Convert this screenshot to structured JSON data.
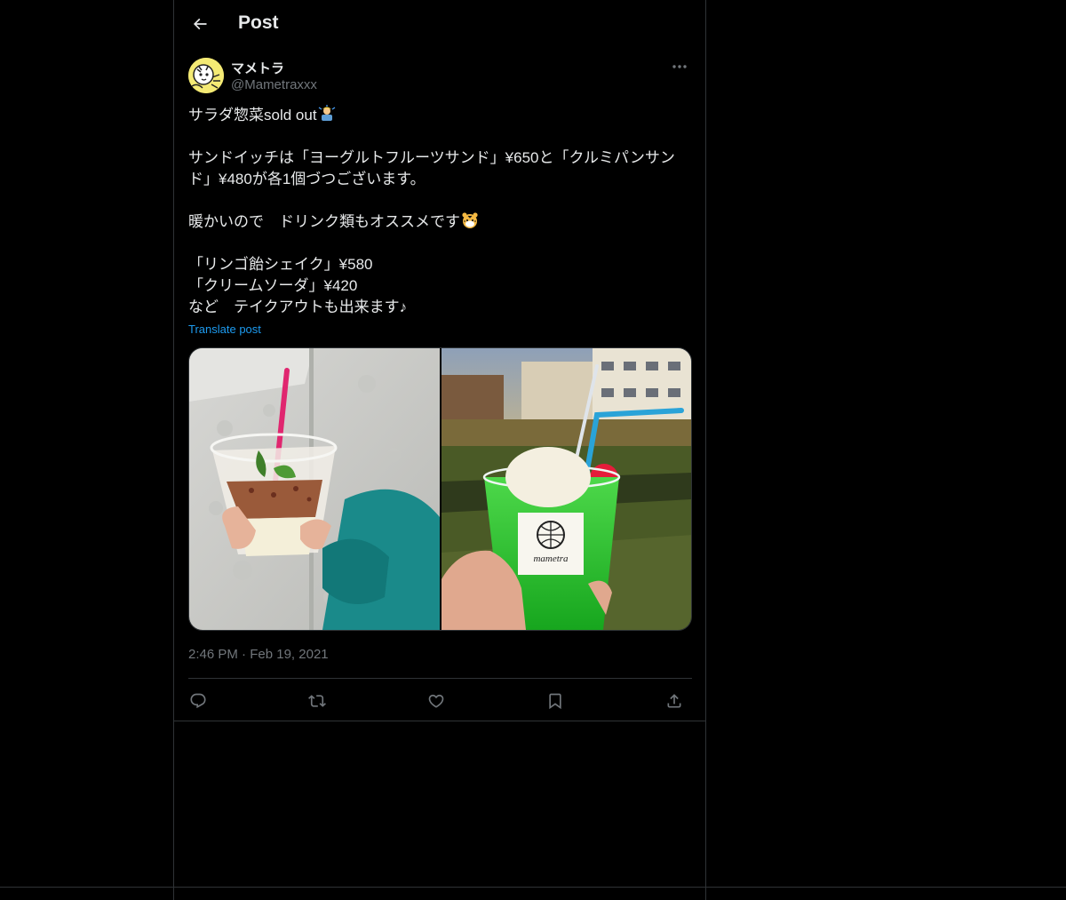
{
  "header": {
    "title": "Post"
  },
  "author": {
    "display_name": "マメトラ",
    "handle": "@Mametraxxx"
  },
  "post": {
    "lines": [
      "サラダ惣菜sold out",
      "",
      "サンドイッチは「ヨーグルトフルーツサンド」¥650と「クルミパンサン",
      "ド」¥480が各1個づつございます。",
      "",
      "暖かいので　ドリンク類もオススメです",
      "",
      "「リンゴ飴シェイク」¥580",
      "「クリームソーダ」¥420",
      "など　テイクアウトも出来ます♪"
    ],
    "translate_label": "Translate post"
  },
  "media": [
    {
      "icon": "yogurt-parfait-photo"
    },
    {
      "icon": "cream-soda-photo",
      "cup_brand": "mametra"
    }
  ],
  "meta": {
    "time": "2:46 PM",
    "separator": "·",
    "date": "Feb 19, 2021"
  },
  "actions": [
    {
      "icon": "reply-icon"
    },
    {
      "icon": "repost-icon"
    },
    {
      "icon": "like-icon"
    },
    {
      "icon": "bookmark-icon"
    },
    {
      "icon": "share-icon"
    }
  ],
  "colors": {
    "background": "#000000",
    "text": "#e7e9ea",
    "muted": "#71767b",
    "link": "#1d9bf0",
    "border": "#2f3336"
  }
}
